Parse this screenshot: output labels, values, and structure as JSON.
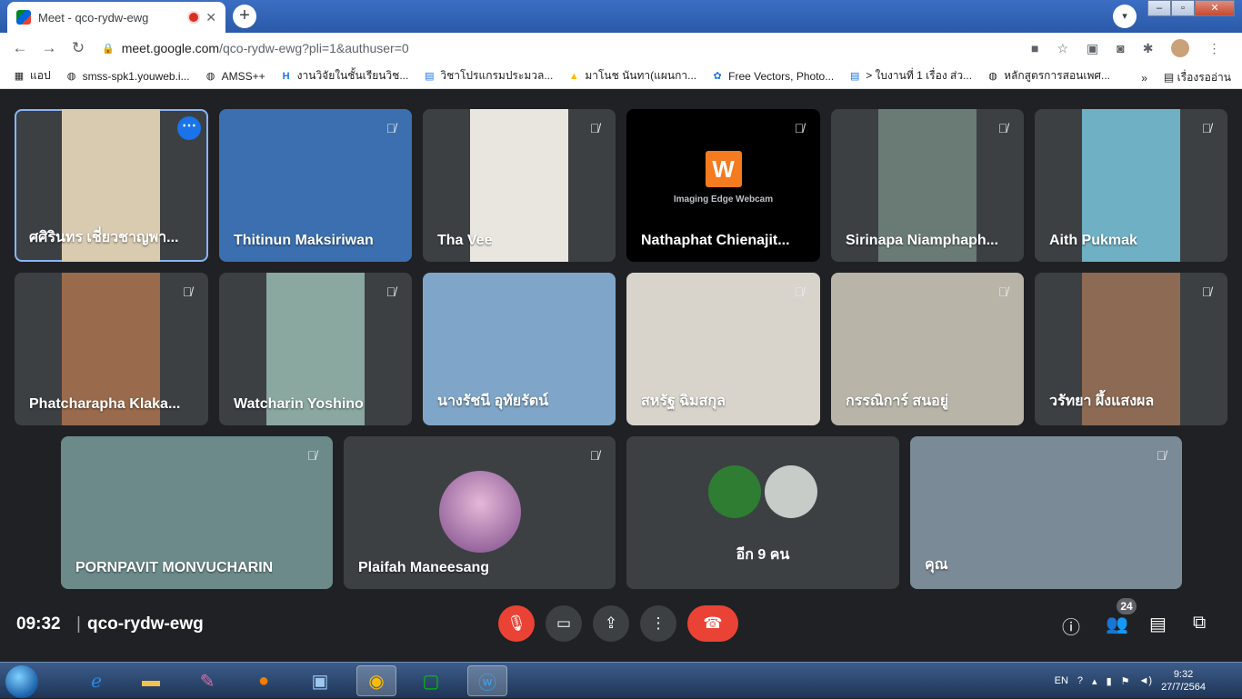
{
  "browser": {
    "tab_title": "Meet - qco-rydw-ewg",
    "tab_close": "✕",
    "new_tab": "+",
    "profile_dropdown": "▾",
    "url_host": "meet.google.com",
    "url_path": "/qco-rydw-ewg?pli=1&authuser=0",
    "bookmarks": [
      "แอป",
      "smss-spk1.youweb.i...",
      "AMSS++",
      "งานวิจัยในชั้นเรียนวิช...",
      "วิชาโปรแกรมประมวล...",
      "มาโนช นันทา(แผนกา...",
      "Free Vectors, Photo...",
      "> ใบงานที่ 1 เรื่อง ส่ว...",
      "หลักสูตรการสอนเพศ..."
    ],
    "bookmarks_more": "»",
    "reading_list": "เรื่องรออ่าน"
  },
  "participants": [
    {
      "name": "ศศิรินทร เชี่ยวชาญพา...",
      "active": true,
      "bg": "#d9cbb0"
    },
    {
      "name": "Thitinun Maksiriwan",
      "bg": "#3b6fb0"
    },
    {
      "name": "Tha Vee",
      "bg": "#e9e6df"
    },
    {
      "name": "Nathaphat Chienajit...",
      "bg": "#000000",
      "webcam_logo": "W",
      "webcam_text": "Imaging Edge Webcam"
    },
    {
      "name": "Sirinapa Niamphaph...",
      "bg": "#6a7a74"
    },
    {
      "name": "Aith Pukmak",
      "bg": "#6fb0c4"
    },
    {
      "name": "Phatcharapha Klaka...",
      "bg": "#9a6a4c"
    },
    {
      "name": "Watcharin Yoshino",
      "bg": "#8aa7a0"
    },
    {
      "name": "นางรัชนี อุทัยรัตน์",
      "bg": "#7fa6c9"
    },
    {
      "name": "สหรัฐ ฉิมสกุล",
      "bg": "#d8d4cc"
    },
    {
      "name": "กรรณิการ์ สนอยู่",
      "bg": "#b8b4a8"
    },
    {
      "name": "วรัทยา ผึ้งแสงผล",
      "bg": "#8c6a54"
    },
    {
      "name": "PORNPAVIT MONVUCHARIN",
      "bg": "#6c8a8a"
    },
    {
      "name": "Plaifah Maneesang",
      "avatar": true
    },
    {
      "name": "อีก 9 คน",
      "others": true
    },
    {
      "name": "คุณ",
      "bg": "#7a8a96"
    }
  ],
  "controls": {
    "time": "09:32",
    "separator": "|",
    "meeting_code": "qco-rydw-ewg",
    "participant_count": "24",
    "colors": {
      "danger": "#ea4335",
      "surface": "#3c4043",
      "accent": "#1a73e8"
    }
  },
  "taskbar": {
    "lang": "EN",
    "time": "9:32",
    "date": "27/7/2564"
  }
}
